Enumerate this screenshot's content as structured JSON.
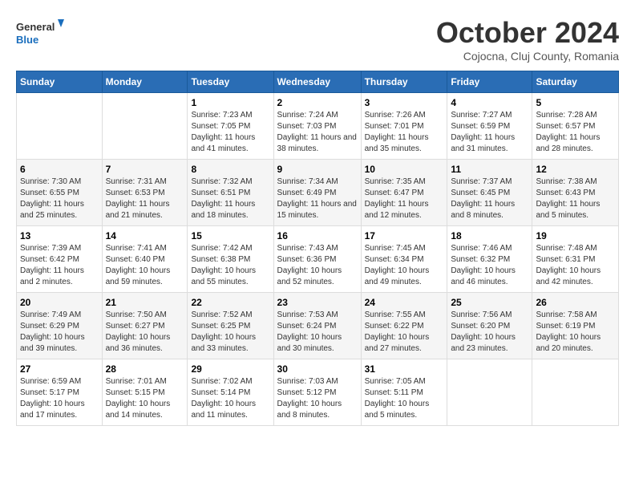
{
  "header": {
    "logo_general": "General",
    "logo_blue": "Blue",
    "month_title": "October 2024",
    "subtitle": "Cojocna, Cluj County, Romania"
  },
  "weekdays": [
    "Sunday",
    "Monday",
    "Tuesday",
    "Wednesday",
    "Thursday",
    "Friday",
    "Saturday"
  ],
  "weeks": [
    [
      {
        "day": "",
        "info": ""
      },
      {
        "day": "",
        "info": ""
      },
      {
        "day": "1",
        "info": "Sunrise: 7:23 AM\nSunset: 7:05 PM\nDaylight: 11 hours and 41 minutes."
      },
      {
        "day": "2",
        "info": "Sunrise: 7:24 AM\nSunset: 7:03 PM\nDaylight: 11 hours and 38 minutes."
      },
      {
        "day": "3",
        "info": "Sunrise: 7:26 AM\nSunset: 7:01 PM\nDaylight: 11 hours and 35 minutes."
      },
      {
        "day": "4",
        "info": "Sunrise: 7:27 AM\nSunset: 6:59 PM\nDaylight: 11 hours and 31 minutes."
      },
      {
        "day": "5",
        "info": "Sunrise: 7:28 AM\nSunset: 6:57 PM\nDaylight: 11 hours and 28 minutes."
      }
    ],
    [
      {
        "day": "6",
        "info": "Sunrise: 7:30 AM\nSunset: 6:55 PM\nDaylight: 11 hours and 25 minutes."
      },
      {
        "day": "7",
        "info": "Sunrise: 7:31 AM\nSunset: 6:53 PM\nDaylight: 11 hours and 21 minutes."
      },
      {
        "day": "8",
        "info": "Sunrise: 7:32 AM\nSunset: 6:51 PM\nDaylight: 11 hours and 18 minutes."
      },
      {
        "day": "9",
        "info": "Sunrise: 7:34 AM\nSunset: 6:49 PM\nDaylight: 11 hours and 15 minutes."
      },
      {
        "day": "10",
        "info": "Sunrise: 7:35 AM\nSunset: 6:47 PM\nDaylight: 11 hours and 12 minutes."
      },
      {
        "day": "11",
        "info": "Sunrise: 7:37 AM\nSunset: 6:45 PM\nDaylight: 11 hours and 8 minutes."
      },
      {
        "day": "12",
        "info": "Sunrise: 7:38 AM\nSunset: 6:43 PM\nDaylight: 11 hours and 5 minutes."
      }
    ],
    [
      {
        "day": "13",
        "info": "Sunrise: 7:39 AM\nSunset: 6:42 PM\nDaylight: 11 hours and 2 minutes."
      },
      {
        "day": "14",
        "info": "Sunrise: 7:41 AM\nSunset: 6:40 PM\nDaylight: 10 hours and 59 minutes."
      },
      {
        "day": "15",
        "info": "Sunrise: 7:42 AM\nSunset: 6:38 PM\nDaylight: 10 hours and 55 minutes."
      },
      {
        "day": "16",
        "info": "Sunrise: 7:43 AM\nSunset: 6:36 PM\nDaylight: 10 hours and 52 minutes."
      },
      {
        "day": "17",
        "info": "Sunrise: 7:45 AM\nSunset: 6:34 PM\nDaylight: 10 hours and 49 minutes."
      },
      {
        "day": "18",
        "info": "Sunrise: 7:46 AM\nSunset: 6:32 PM\nDaylight: 10 hours and 46 minutes."
      },
      {
        "day": "19",
        "info": "Sunrise: 7:48 AM\nSunset: 6:31 PM\nDaylight: 10 hours and 42 minutes."
      }
    ],
    [
      {
        "day": "20",
        "info": "Sunrise: 7:49 AM\nSunset: 6:29 PM\nDaylight: 10 hours and 39 minutes."
      },
      {
        "day": "21",
        "info": "Sunrise: 7:50 AM\nSunset: 6:27 PM\nDaylight: 10 hours and 36 minutes."
      },
      {
        "day": "22",
        "info": "Sunrise: 7:52 AM\nSunset: 6:25 PM\nDaylight: 10 hours and 33 minutes."
      },
      {
        "day": "23",
        "info": "Sunrise: 7:53 AM\nSunset: 6:24 PM\nDaylight: 10 hours and 30 minutes."
      },
      {
        "day": "24",
        "info": "Sunrise: 7:55 AM\nSunset: 6:22 PM\nDaylight: 10 hours and 27 minutes."
      },
      {
        "day": "25",
        "info": "Sunrise: 7:56 AM\nSunset: 6:20 PM\nDaylight: 10 hours and 23 minutes."
      },
      {
        "day": "26",
        "info": "Sunrise: 7:58 AM\nSunset: 6:19 PM\nDaylight: 10 hours and 20 minutes."
      }
    ],
    [
      {
        "day": "27",
        "info": "Sunrise: 6:59 AM\nSunset: 5:17 PM\nDaylight: 10 hours and 17 minutes."
      },
      {
        "day": "28",
        "info": "Sunrise: 7:01 AM\nSunset: 5:15 PM\nDaylight: 10 hours and 14 minutes."
      },
      {
        "day": "29",
        "info": "Sunrise: 7:02 AM\nSunset: 5:14 PM\nDaylight: 10 hours and 11 minutes."
      },
      {
        "day": "30",
        "info": "Sunrise: 7:03 AM\nSunset: 5:12 PM\nDaylight: 10 hours and 8 minutes."
      },
      {
        "day": "31",
        "info": "Sunrise: 7:05 AM\nSunset: 5:11 PM\nDaylight: 10 hours and 5 minutes."
      },
      {
        "day": "",
        "info": ""
      },
      {
        "day": "",
        "info": ""
      }
    ]
  ]
}
